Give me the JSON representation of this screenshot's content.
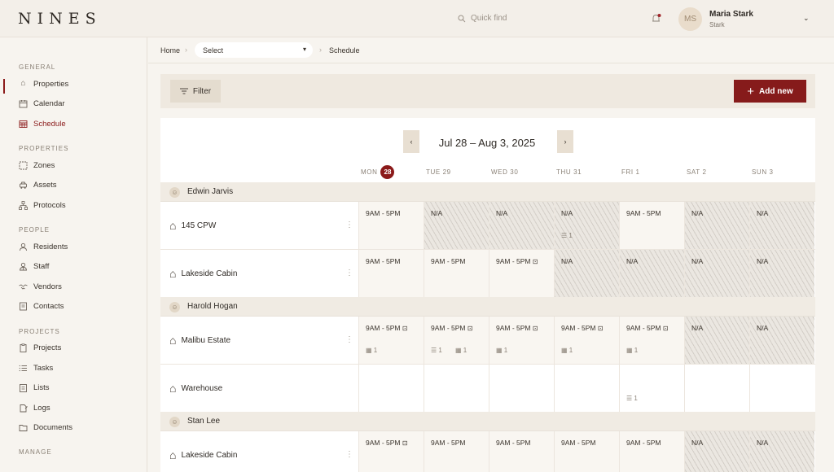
{
  "app": {
    "logo": "NINES",
    "quick_find": "Quick find"
  },
  "user": {
    "initials": "MS",
    "name": "Maria Stark",
    "role": "Stark"
  },
  "sidebar": {
    "sections": [
      {
        "title": "GENERAL",
        "items": [
          {
            "label": "Properties",
            "icon": "house-icon"
          },
          {
            "label": "Calendar",
            "icon": "calendar-icon"
          },
          {
            "label": "Schedule",
            "icon": "schedule-icon",
            "active": true
          }
        ]
      },
      {
        "title": "PROPERTIES",
        "items": [
          {
            "label": "Zones",
            "icon": "zones-icon"
          },
          {
            "label": "Assets",
            "icon": "car-icon"
          },
          {
            "label": "Protocols",
            "icon": "hierarchy-icon"
          }
        ]
      },
      {
        "title": "PEOPLE",
        "items": [
          {
            "label": "Residents",
            "icon": "person-icon"
          },
          {
            "label": "Staff",
            "icon": "staff-icon"
          },
          {
            "label": "Vendors",
            "icon": "handshake-icon"
          },
          {
            "label": "Contacts",
            "icon": "contacts-icon"
          }
        ]
      },
      {
        "title": "PROJECTS",
        "items": [
          {
            "label": "Projects",
            "icon": "clipboard-icon"
          },
          {
            "label": "Tasks",
            "icon": "list-icon"
          },
          {
            "label": "Lists",
            "icon": "checklist-icon"
          },
          {
            "label": "Logs",
            "icon": "log-icon"
          },
          {
            "label": "Documents",
            "icon": "folder-icon"
          }
        ]
      },
      {
        "title": "MANAGE",
        "items": []
      }
    ]
  },
  "breadcrumb": {
    "home": "Home",
    "select": "Select",
    "current": "Schedule"
  },
  "toolbar": {
    "filter": "Filter",
    "add_new": "Add new"
  },
  "schedule": {
    "range": "Jul 28 – Aug 3, 2025",
    "prev": "‹",
    "next": "›",
    "days": [
      {
        "label": "MON",
        "num": "28",
        "today": true
      },
      {
        "label": "TUE 29"
      },
      {
        "label": "WED 30"
      },
      {
        "label": "THU 31"
      },
      {
        "label": "FRI 1"
      },
      {
        "label": "SAT 2"
      },
      {
        "label": "SUN 3"
      }
    ],
    "groups": [
      {
        "name": "Edwin Jarvis",
        "properties": [
          {
            "name": "145 CPW",
            "cells": [
              {
                "time": "9AM - 5PM"
              },
              {
                "time": "N/A",
                "hatch": true
              },
              {
                "time": "N/A",
                "hatch": true
              },
              {
                "time": "N/A",
                "hatch": true,
                "stats": [
                  {
                    "icon": "list-icon",
                    "text": "1"
                  }
                ]
              },
              {
                "time": "9AM - 5PM"
              },
              {
                "time": "N/A",
                "hatch": true
              },
              {
                "time": "N/A",
                "hatch": true
              }
            ]
          },
          {
            "name": "Lakeside Cabin",
            "cells": [
              {
                "time": "9AM - 5PM"
              },
              {
                "time": "9AM - 5PM"
              },
              {
                "time": "9AM - 5PM",
                "note": true
              },
              {
                "time": "N/A",
                "hatch": true
              },
              {
                "time": "N/A",
                "hatch": true
              },
              {
                "time": "N/A",
                "hatch": true
              },
              {
                "time": "N/A",
                "hatch": true
              }
            ]
          }
        ]
      },
      {
        "name": "Harold Hogan",
        "properties": [
          {
            "name": "Malibu Estate",
            "cells": [
              {
                "time": "9AM - 5PM",
                "note": true,
                "stats": [
                  {
                    "icon": "calendar-icon",
                    "text": "1"
                  }
                ]
              },
              {
                "time": "9AM - 5PM",
                "note": true,
                "stats": [
                  {
                    "icon": "list-icon",
                    "text": "1"
                  },
                  {
                    "icon": "calendar-icon",
                    "text": "1"
                  }
                ]
              },
              {
                "time": "9AM - 5PM",
                "note": true,
                "stats": [
                  {
                    "icon": "calendar-icon",
                    "text": "1"
                  }
                ]
              },
              {
                "time": "9AM - 5PM",
                "note": true,
                "stats": [
                  {
                    "icon": "calendar-icon",
                    "text": "1"
                  }
                ]
              },
              {
                "time": "9AM - 5PM",
                "note": true,
                "stats": [
                  {
                    "icon": "calendar-icon",
                    "text": "1"
                  }
                ]
              },
              {
                "time": "N/A",
                "hatch": true
              },
              {
                "time": "N/A",
                "hatch": true
              }
            ]
          },
          {
            "name": "Warehouse",
            "white": true,
            "cells": [
              {
                "time": ""
              },
              {
                "time": ""
              },
              {
                "time": ""
              },
              {
                "time": ""
              },
              {
                "time": "",
                "stats": [
                  {
                    "icon": "list-icon",
                    "text": "1"
                  }
                ]
              },
              {
                "time": ""
              },
              {
                "time": ""
              }
            ]
          }
        ]
      },
      {
        "name": "Stan Lee",
        "properties": [
          {
            "name": "Lakeside Cabin",
            "cells": [
              {
                "time": "9AM - 5PM",
                "note": true
              },
              {
                "time": "9AM - 5PM"
              },
              {
                "time": "9AM - 5PM"
              },
              {
                "time": "9AM - 5PM"
              },
              {
                "time": "9AM - 5PM"
              },
              {
                "time": "N/A",
                "hatch": true
              },
              {
                "time": "N/A",
                "hatch": true
              }
            ]
          }
        ]
      }
    ]
  }
}
